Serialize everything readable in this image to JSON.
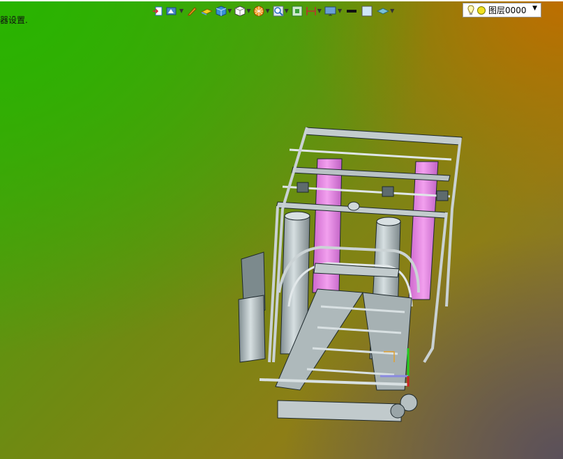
{
  "viewport": {
    "hint_text": "器设置."
  },
  "toolbar": {
    "tools": [
      {
        "name": "exit-icon",
        "has_menu": false
      },
      {
        "name": "view-icon",
        "has_menu": true
      },
      {
        "name": "pen-icon",
        "has_menu": false
      },
      {
        "name": "plane-icon",
        "has_menu": false
      },
      {
        "name": "cube-blue-icon",
        "has_menu": true
      },
      {
        "name": "cube-white-icon",
        "has_menu": true
      },
      {
        "name": "render-ball-icon",
        "has_menu": true
      },
      {
        "name": "zoom-icon",
        "has_menu": true
      },
      {
        "name": "frame-icon",
        "has_menu": false
      },
      {
        "name": "dimension-icon",
        "has_menu": true
      },
      {
        "name": "display-icon",
        "has_menu": true
      },
      {
        "name": "line-color-icon",
        "has_menu": false
      },
      {
        "name": "fill-color-icon",
        "has_menu": false
      },
      {
        "name": "layer-stack-icon",
        "has_menu": true
      }
    ],
    "layer_select": {
      "value": "图层0000"
    }
  },
  "colors": {
    "accent_pink": "#ee88dd",
    "frame_grey": "#b9c4c6"
  }
}
